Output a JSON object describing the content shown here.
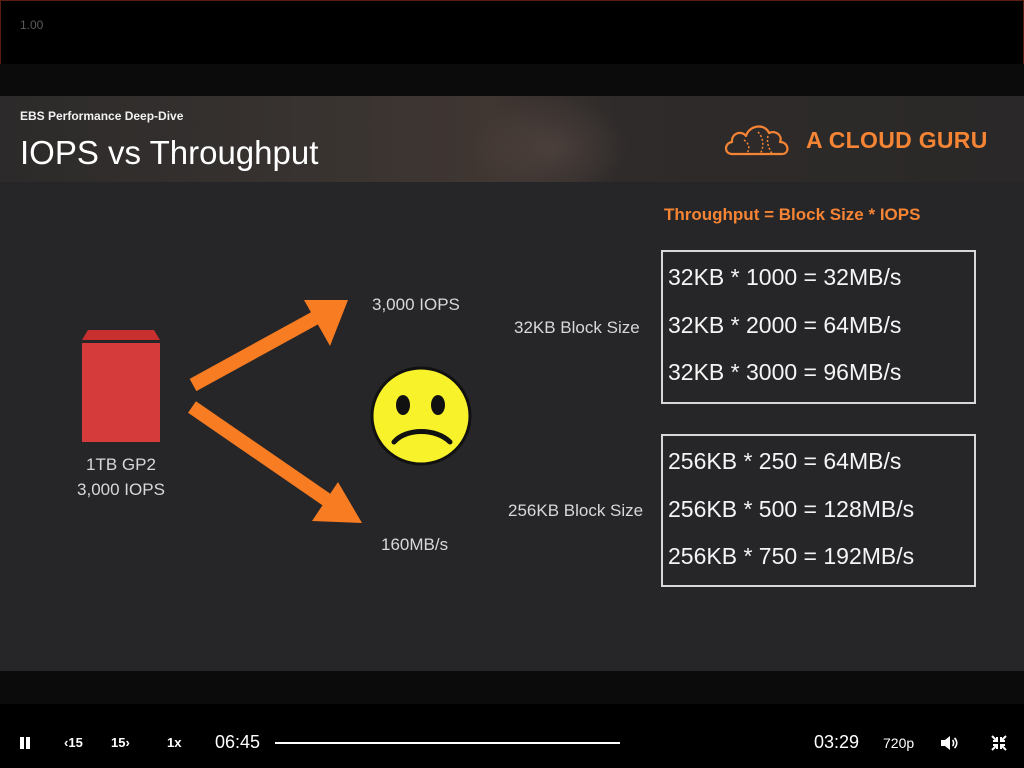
{
  "overlay": {
    "playback_rate_display": "1.00"
  },
  "slide": {
    "subtitle": "EBS Performance Deep-Dive",
    "title": "IOPS vs Throughput",
    "brand": {
      "name": "A CLOUD GURU",
      "color": "#f58434"
    },
    "formula": "Throughput = Block Size * IOPS",
    "disk": {
      "label_line1": "1TB GP2",
      "label_line2": "3,000 IOPS",
      "color": "#d63b3b"
    },
    "arrow_color": "#f77c22",
    "top_branch_label": "3,000 IOPS",
    "bottom_branch_label": "160MB/s",
    "face_icon": "sad-face-icon",
    "blocks": [
      {
        "label": "32KB Block Size",
        "lines": [
          "32KB * 1000 = 32MB/s",
          "32KB * 2000 = 64MB/s",
          "32KB * 3000 = 96MB/s"
        ]
      },
      {
        "label": "256KB Block Size",
        "lines": [
          "256KB * 250 = 64MB/s",
          "256KB * 500 = 128MB/s",
          "256KB * 750 = 192MB/s"
        ]
      }
    ]
  },
  "controls": {
    "pause_icon": "pause-icon",
    "rewind_label": "15",
    "forward_label": "15",
    "speed_label": "1x",
    "current_time": "06:45",
    "remaining_time": "03:29",
    "quality_label": "720p",
    "volume_icon": "volume-icon",
    "fullscreen_icon": "exit-fullscreen-icon"
  }
}
